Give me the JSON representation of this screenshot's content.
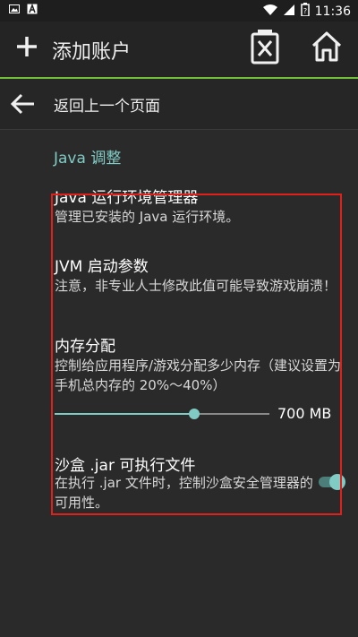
{
  "status_bar": {
    "time": "11:36",
    "left_icons": [
      "image-icon",
      "app-a-icon"
    ],
    "right_icons": [
      "wifi-icon",
      "signal-icon",
      "battery-icon"
    ]
  },
  "toolbar": {
    "title": "添加账户",
    "add_icon": "plus-icon",
    "delete_icon": "delete-box-icon",
    "home_icon": "home-icon"
  },
  "back_bar": {
    "label": "返回上一个页面"
  },
  "section": {
    "title": "Java 调整"
  },
  "prefs": {
    "java_manager": {
      "title": "Java 运行环境管理器",
      "summary": "管理已安装的 Java 运行环境。"
    },
    "jvm_args": {
      "title": "JVM 启动参数",
      "summary": "注意，非专业人士修改此值可能导致游戏崩溃！"
    },
    "memory": {
      "title": "内存分配",
      "summary": "控制给应用程序/游戏分配多少内存（建议设置为手机总内存的 20%～40%）",
      "value_label": "700 MB",
      "slider_fraction": 0.65
    },
    "sandbox": {
      "title": "沙盒 .jar 可执行文件",
      "summary": "在执行 .jar 文件时，控制沙盒安全管理器的可用性。",
      "enabled": true
    }
  },
  "colors": {
    "accent": "#80cbc4",
    "toolbar_line": "#6fbf3a",
    "highlight_box": "#e0201a"
  }
}
